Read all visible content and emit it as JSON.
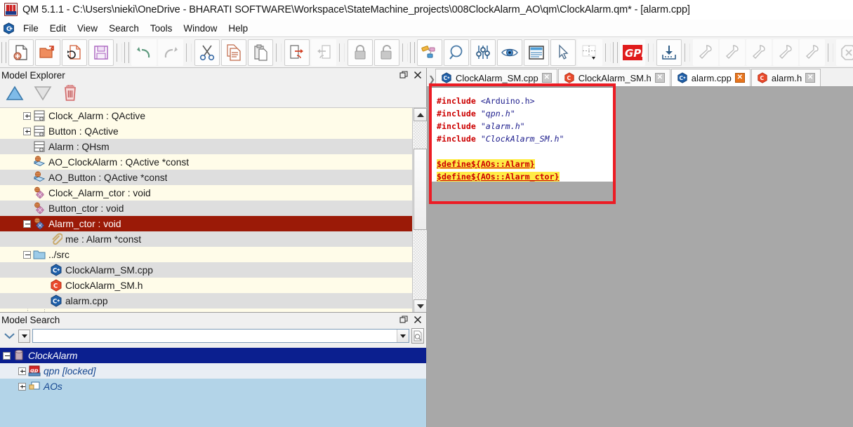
{
  "window": {
    "title": "QM 5.1.1 - C:\\Users\\nieki\\OneDrive - BHARATI SOFTWARE\\Workspace\\StateMachine_projects\\008ClockAlarm_AO\\qm\\ClockAlarm.qm* - [alarm.cpp]",
    "logo_icon": "qm-app-icon"
  },
  "menubar": {
    "logo_icon": "qm-cpp-icon",
    "items": [
      {
        "label": "File",
        "name": "menu-file"
      },
      {
        "label": "Edit",
        "name": "menu-edit"
      },
      {
        "label": "View",
        "name": "menu-view"
      },
      {
        "label": "Search",
        "name": "menu-search"
      },
      {
        "label": "Tools",
        "name": "menu-tools"
      },
      {
        "label": "Window",
        "name": "menu-window"
      },
      {
        "label": "Help",
        "name": "menu-help"
      }
    ]
  },
  "toolbar": {
    "groups": [
      {
        "items": [
          {
            "icon": "new-file-icon",
            "name": "new-model-button",
            "enabled": true
          },
          {
            "icon": "open-folder-icon",
            "name": "open-model-button",
            "enabled": true
          },
          {
            "icon": "reload-file-icon",
            "name": "reload-model-button",
            "enabled": true
          },
          {
            "icon": "save-floppy-icon",
            "name": "save-model-button",
            "enabled": true
          }
        ]
      },
      {
        "items": [
          {
            "icon": "undo-arrow-icon",
            "name": "undo-button",
            "enabled": true
          },
          {
            "icon": "redo-arrow-icon",
            "name": "redo-button",
            "enabled": false
          }
        ]
      },
      {
        "items": [
          {
            "icon": "scissors-icon",
            "name": "cut-button",
            "enabled": true
          },
          {
            "icon": "copy-pages-icon",
            "name": "copy-button",
            "enabled": true
          },
          {
            "icon": "clipboard-paste-icon",
            "name": "paste-button",
            "enabled": true
          }
        ]
      },
      {
        "items": [
          {
            "icon": "export-link-icon",
            "name": "goto-definition-button",
            "enabled": true
          },
          {
            "icon": "import-link-icon",
            "name": "goto-declaration-button",
            "enabled": false
          }
        ]
      },
      {
        "items": [
          {
            "icon": "lock-closed-icon",
            "name": "lock-button",
            "enabled": false
          },
          {
            "icon": "lock-open-icon",
            "name": "unlock-button",
            "enabled": false
          }
        ]
      },
      {
        "items": [
          {
            "icon": "diagram-shapes-icon",
            "name": "show-diagram-button",
            "enabled": true
          },
          {
            "icon": "magnifier-icon",
            "name": "zoom-button",
            "enabled": true
          },
          {
            "icon": "sliders-icon",
            "name": "preferences-button",
            "enabled": true
          },
          {
            "icon": "eye-icon",
            "name": "show-hide-button",
            "enabled": true
          },
          {
            "icon": "document-lines-icon",
            "name": "code-view-button",
            "enabled": true
          },
          {
            "icon": "cursor-pointer-icon",
            "name": "select-tool-button",
            "enabled": true
          },
          {
            "icon": "grid-snap-icon",
            "name": "grid-dropdown-button",
            "enabled": true
          }
        ]
      },
      {
        "items": [
          {
            "icon": "gpl-badge-icon",
            "name": "license-button",
            "enabled": true
          }
        ]
      },
      {
        "items": [
          {
            "icon": "generate-code-icon",
            "name": "generate-code-button",
            "enabled": true
          }
        ]
      },
      {
        "items": [
          {
            "icon": "hammer-icon",
            "name": "build-button-1",
            "enabled": false
          },
          {
            "icon": "hammer-icon",
            "name": "build-button-2",
            "enabled": false
          },
          {
            "icon": "hammer-icon",
            "name": "build-button-3",
            "enabled": false
          },
          {
            "icon": "hammer-icon",
            "name": "build-button-4",
            "enabled": false
          },
          {
            "icon": "hammer-icon",
            "name": "build-button-5",
            "enabled": false
          }
        ]
      },
      {
        "items": [
          {
            "icon": "stop-octagon-icon",
            "name": "stop-build-button",
            "enabled": false
          }
        ]
      },
      {
        "items": [
          {
            "icon": "hammer-gear-icon",
            "name": "configure-build-button",
            "enabled": true
          }
        ]
      }
    ]
  },
  "model_explorer": {
    "title": "Model Explorer",
    "float_icon": "restore-window-icon",
    "close_icon": "close-icon",
    "tools": [
      {
        "icon": "move-up-triangle-icon",
        "name": "move-up-button",
        "enabled": true
      },
      {
        "icon": "move-down-triangle-icon",
        "name": "move-down-button",
        "enabled": false
      },
      {
        "icon": "trash-icon",
        "name": "delete-button",
        "enabled": true
      }
    ],
    "tree": [
      {
        "label": "Clock_Alarm : QActive",
        "icon": "class-icon",
        "indent": 1,
        "expander": "plus",
        "selected": false
      },
      {
        "label": "Button : QActive",
        "icon": "class-icon",
        "indent": 1,
        "expander": "plus",
        "selected": false
      },
      {
        "label": "Alarm : QHsm",
        "icon": "class-icon",
        "indent": 1,
        "expander": "none",
        "selected": false
      },
      {
        "label": "AO_ClockAlarm : QActive *const",
        "icon": "attribute-icon",
        "indent": 1,
        "expander": "none",
        "selected": false
      },
      {
        "label": "AO_Button : QActive *const",
        "icon": "attribute-icon",
        "indent": 1,
        "expander": "none",
        "selected": false
      },
      {
        "label": "Clock_Alarm_ctor : void",
        "icon": "operation-icon",
        "indent": 1,
        "expander": "none",
        "selected": false
      },
      {
        "label": "Button_ctor : void",
        "icon": "operation-icon",
        "indent": 1,
        "expander": "none",
        "selected": false
      },
      {
        "label": "Alarm_ctor : void",
        "icon": "operation-icon",
        "indent": 1,
        "expander": "minus",
        "selected": true
      },
      {
        "label": "me : Alarm *const",
        "icon": "parameter-icon",
        "indent": 2,
        "expander": "none",
        "selected": false
      },
      {
        "label": "../src",
        "icon": "folder-icon",
        "indent": 1,
        "expander": "minus",
        "selected": false
      },
      {
        "label": "ClockAlarm_SM.cpp",
        "icon": "cpp-file-icon",
        "indent": 2,
        "expander": "none",
        "selected": false
      },
      {
        "label": "ClockAlarm_SM.h",
        "icon": "h-file-icon",
        "indent": 2,
        "expander": "none",
        "selected": false
      },
      {
        "label": "alarm.cpp",
        "icon": "cpp-file-icon",
        "indent": 2,
        "expander": "none",
        "selected": false
      }
    ],
    "scrollbar": {
      "up_icon": "scroll-up-arrow-icon",
      "down_icon": "scroll-down-arrow-icon"
    }
  },
  "model_search": {
    "title": "Model Search",
    "float_icon": "restore-window-icon",
    "close_icon": "close-icon",
    "collapse_icon": "chevron-down-icon",
    "dropdown_icon": "dropdown-arrow-icon",
    "search_value": "",
    "search_placeholder": "",
    "search_combo_icon": "combo-arrow-icon",
    "find_icon": "find-document-icon",
    "results": [
      {
        "label": "ClockAlarm",
        "icon": "model-root-icon",
        "indent": 0,
        "expander": "minus",
        "selected": true
      },
      {
        "label": "qpn [locked]",
        "icon": "package-qp-icon",
        "indent": 1,
        "expander": "plus",
        "selected": false
      },
      {
        "label": "AOs",
        "icon": "package-icon",
        "indent": 1,
        "expander": "plus",
        "selected": false
      }
    ]
  },
  "editor": {
    "overflow_icon": "tab-overflow-icon",
    "tabs": [
      {
        "label": "ClockAlarm_SM.cpp",
        "icon": "cpp-file-icon",
        "active": false,
        "close_icon": "close-icon",
        "close_hot": false
      },
      {
        "label": "ClockAlarm_SM.h",
        "icon": "h-file-icon",
        "active": false,
        "close_icon": "close-icon",
        "close_hot": false
      },
      {
        "label": "alarm.cpp",
        "icon": "cpp-file-icon",
        "active": true,
        "close_icon": "close-icon",
        "close_hot": true
      },
      {
        "label": "alarm.h",
        "icon": "h-file-icon",
        "active": false,
        "close_icon": "close-icon",
        "close_hot": false
      }
    ],
    "code_lines": [
      [
        {
          "t": "#include",
          "c": "kw"
        },
        {
          "t": " ",
          "c": "plain"
        },
        {
          "t": "<Arduino.h>",
          "c": "ang"
        }
      ],
      [
        {
          "t": "#include",
          "c": "kw"
        },
        {
          "t": " ",
          "c": "plain"
        },
        {
          "t": "\"qpn.h\"",
          "c": "str"
        }
      ],
      [
        {
          "t": "#include",
          "c": "kw"
        },
        {
          "t": " ",
          "c": "plain"
        },
        {
          "t": "\"alarm.h\"",
          "c": "str"
        }
      ],
      [
        {
          "t": "#include",
          "c": "kw"
        },
        {
          "t": " ",
          "c": "plain"
        },
        {
          "t": "\"ClockAlarm_SM.h\"",
          "c": "str"
        }
      ],
      [],
      [
        {
          "t": "$define${AOs::Alarm}",
          "c": "macro"
        }
      ],
      [
        {
          "t": "$define${AOs::Alarm_ctor}",
          "c": "macro"
        }
      ]
    ]
  },
  "annotation": {
    "color": "#ec1c24",
    "shape": "rectangle-highlight"
  }
}
